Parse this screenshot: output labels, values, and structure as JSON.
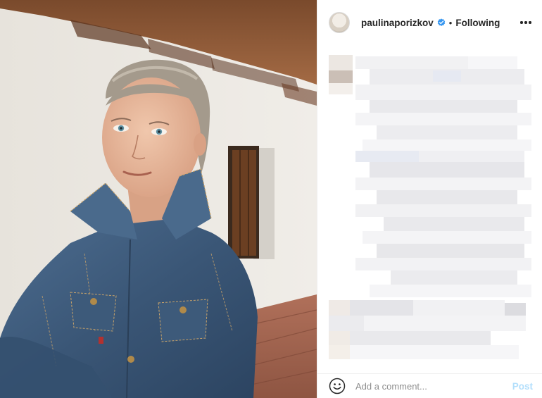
{
  "post": {
    "photo": {
      "subject": "photo-woman-denim-jacket"
    },
    "header": {
      "username": "paulinaporizkov",
      "verified_icon": "verified-badge-icon",
      "separator": "•",
      "follow_status": "Following",
      "more_icon": "more-options-icon"
    },
    "caption": {
      "blurred": true
    },
    "footer": {
      "emoji_icon": "emoji-smiley-icon",
      "comment_placeholder": "Add a comment...",
      "post_label": "Post"
    }
  },
  "colors": {
    "text": "#262626",
    "secondary_text": "#8e8e8e",
    "verified_blue": "#3897f0",
    "post_disabled": "#b3dffc",
    "denim": "#3d5a7a",
    "wall": "#ebe7e1"
  }
}
